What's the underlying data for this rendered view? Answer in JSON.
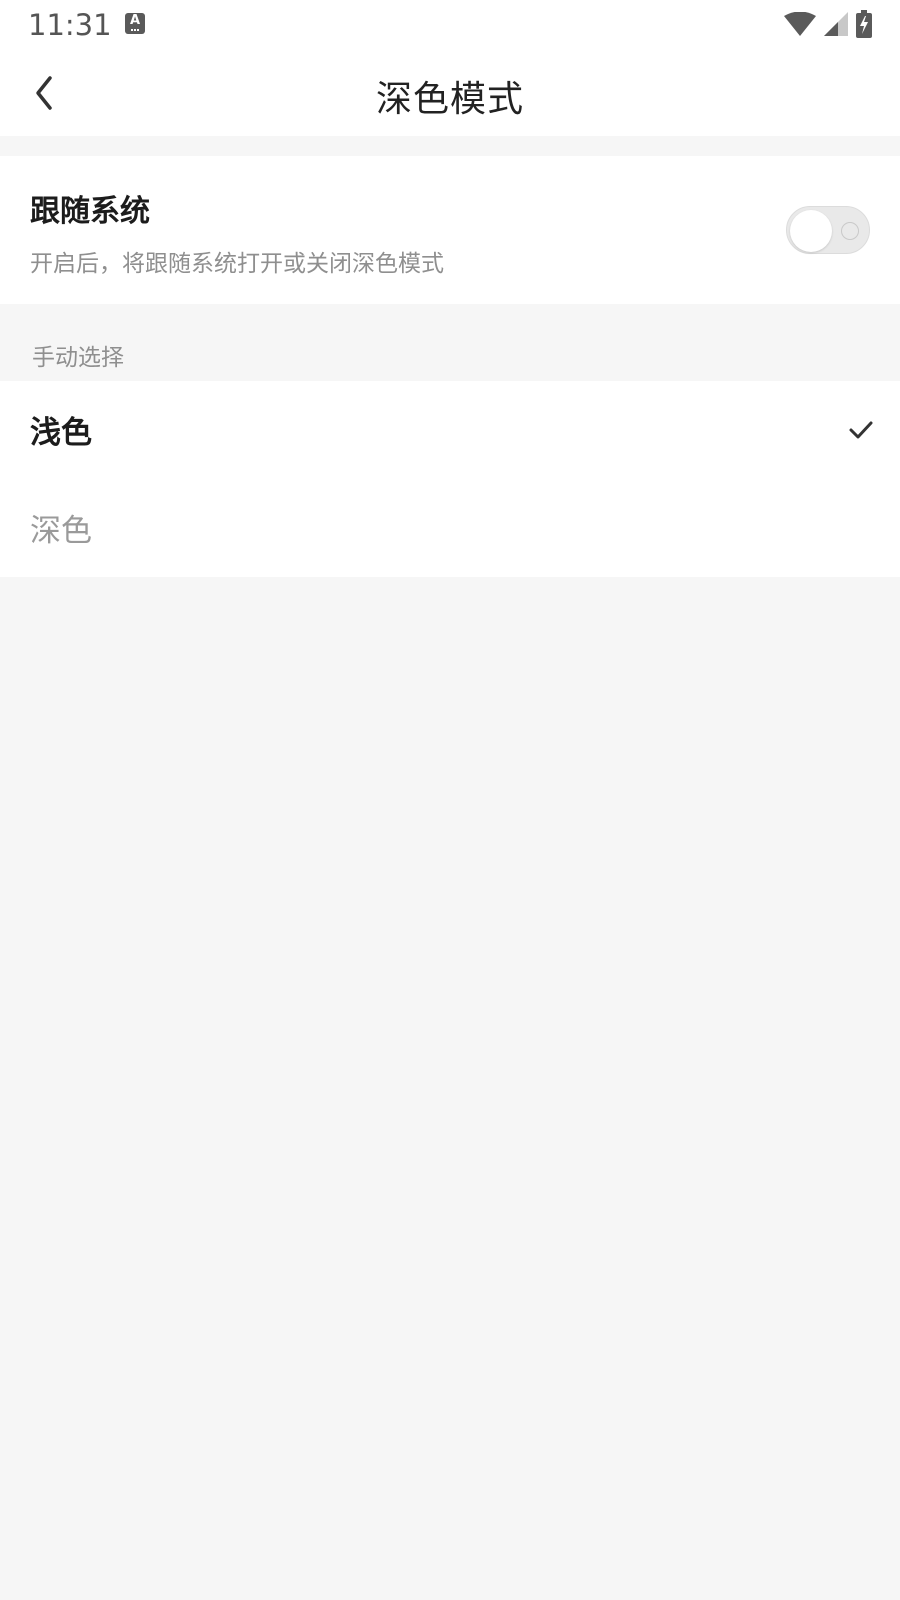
{
  "status_bar": {
    "time": "11:31",
    "keyboard_icon": "keyboard-a-icon",
    "icons": [
      "wifi-icon",
      "signal-icon",
      "battery-charging-icon"
    ]
  },
  "header": {
    "title": "深色模式",
    "back_icon": "chevron-left-icon"
  },
  "follow_system": {
    "title": "跟随系统",
    "description": "开启后，将跟随系统打开或关闭深色模式",
    "enabled": false
  },
  "manual": {
    "section_label": "手动选择",
    "options": [
      {
        "label": "浅色",
        "selected": true
      },
      {
        "label": "深色",
        "selected": false
      }
    ]
  },
  "colors": {
    "background": "#f6f6f6",
    "surface": "#ffffff",
    "primary_text": "#1c1c1c",
    "secondary_text": "#8f8f8f"
  }
}
